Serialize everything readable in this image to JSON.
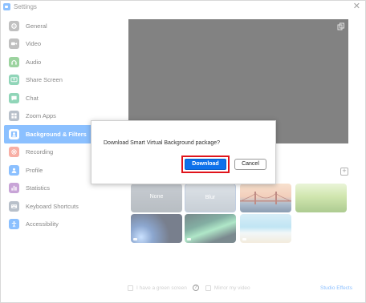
{
  "window": {
    "title": "Settings",
    "close_glyph": "✕"
  },
  "sidebar": {
    "items": [
      {
        "label": "General",
        "icon": "gear-icon",
        "color": "#8c8c8c"
      },
      {
        "label": "Video",
        "icon": "video-icon",
        "color": "#8c8c8c"
      },
      {
        "label": "Audio",
        "icon": "headphones-icon",
        "color": "#4caf50"
      },
      {
        "label": "Share Screen",
        "icon": "share-screen-icon",
        "color": "#35b37e"
      },
      {
        "label": "Chat",
        "icon": "chat-icon",
        "color": "#35b37e"
      },
      {
        "label": "Zoom Apps",
        "icon": "apps-icon",
        "color": "#7f8c9e"
      },
      {
        "label": "Background & Filters",
        "icon": "person-background-icon",
        "color": "#2d8cff",
        "active": true
      },
      {
        "label": "Recording",
        "icon": "record-icon",
        "color": "#f26d5b"
      },
      {
        "label": "Profile",
        "icon": "profile-icon",
        "color": "#2d8cff"
      },
      {
        "label": "Statistics",
        "icon": "stats-icon",
        "color": "#9b59b6"
      },
      {
        "label": "Keyboard Shortcuts",
        "icon": "keyboard-icon",
        "color": "#7f8c9e"
      },
      {
        "label": "Accessibility",
        "icon": "accessibility-icon",
        "color": "#2d8cff"
      }
    ]
  },
  "backgrounds": {
    "items": [
      {
        "label": "None"
      },
      {
        "label": "Blur"
      }
    ]
  },
  "bottom": {
    "green_screen_label": "I have a green screen",
    "mirror_label": "Mirror my video",
    "studio_effects_label": "Studio Effects",
    "help_glyph": "?"
  },
  "dialog": {
    "message": "Download Smart Virtual Background package?",
    "download_label": "Download",
    "cancel_label": "Cancel"
  },
  "colors": {
    "accent": "#2d8cff",
    "highlight": "#e0141b",
    "preview_bg": "#1d1d1d"
  }
}
